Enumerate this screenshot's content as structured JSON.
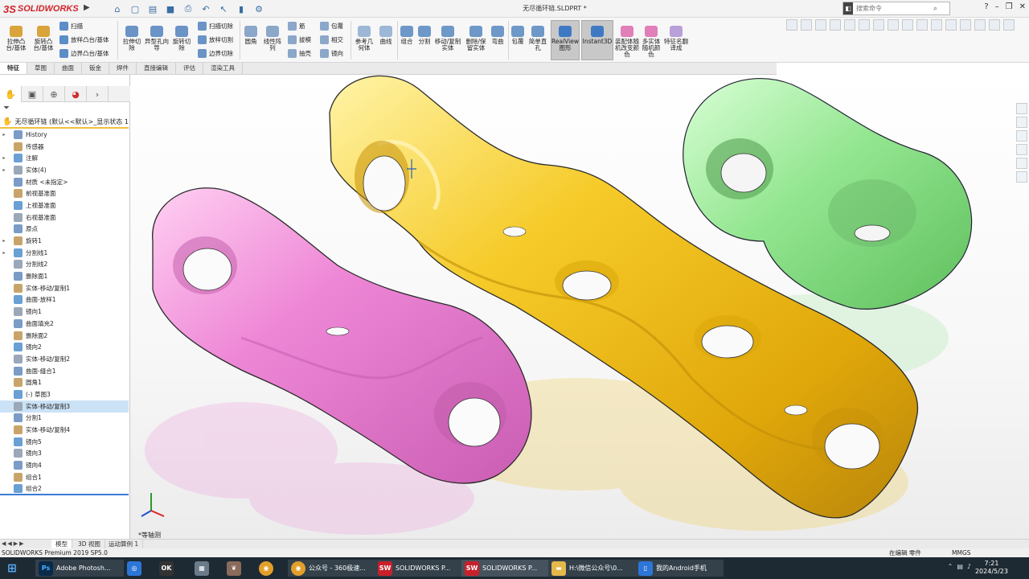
{
  "app": {
    "logo_ds": "3S",
    "logo_text": "SOLIDWORKS",
    "doc_title": "无尽循环链.SLDPRT *"
  },
  "search": {
    "placeholder": "搜索命令"
  },
  "quick_icons": [
    "home-icon",
    "new-doc-icon",
    "open-icon",
    "save-icon",
    "print-icon",
    "undo-icon",
    "select-icon",
    "rebuild-icon",
    "options-icon"
  ],
  "ribbon": {
    "extrude_boss": "拉伸凸台/基体",
    "revolve_boss": "旋转凸台/基体",
    "sweep": "扫描",
    "loft_boss": "放样凸台/基体",
    "boundary_boss": "边界凸台/基体",
    "extrude_cut": "拉伸切除",
    "hole_wizard": "异型孔向导",
    "revolve_cut": "旋转切除",
    "swept_cut": "扫描切除",
    "lofted_cut": "放样切割",
    "boundary_cut": "边界切除",
    "fillet": "圆角",
    "linear_pattern": "线性阵列",
    "rib": "筋",
    "draft": "拔模",
    "shell": "抽壳",
    "wrap": "包覆",
    "intersect": "相交",
    "mirror": "镜向",
    "ref_geometry": "参考几何体",
    "curves": "曲线",
    "combine": "组合",
    "split": "分割",
    "move_copy": "移动/复制实体",
    "delete_keep": "删除/保留实体",
    "flex": "弯曲",
    "wrap2": "包覆",
    "simple_hole": "简单直孔",
    "realview": "RealView图形",
    "instant3d": "Instant3D",
    "random_color_assembly": "装配体随机改变颜色",
    "random_color_body": "多实体随机颜色",
    "feature_translate": "特征名翻译成"
  },
  "command_tabs": [
    "特征",
    "草图",
    "曲面",
    "钣金",
    "焊件",
    "直接编辑",
    "评估",
    "渲染工具"
  ],
  "feature_tree": {
    "root": "无尽循环链 (默认<<默认>_显示状态 1",
    "items": [
      {
        "label": "History",
        "exp": "▸"
      },
      {
        "label": "传感器",
        "exp": ""
      },
      {
        "label": "注解",
        "exp": "▸"
      },
      {
        "label": "实体(4)",
        "exp": "▸"
      },
      {
        "label": "材质 <未指定>",
        "exp": ""
      },
      {
        "label": "前视基准面",
        "exp": ""
      },
      {
        "label": "上视基准面",
        "exp": ""
      },
      {
        "label": "右视基准面",
        "exp": ""
      },
      {
        "label": "原点",
        "exp": ""
      },
      {
        "label": "旋转1",
        "exp": "▸"
      },
      {
        "label": "分割线1",
        "exp": "▸"
      },
      {
        "label": "分割线2",
        "exp": ""
      },
      {
        "label": "删除面1",
        "exp": ""
      },
      {
        "label": "实体-移动/复制1",
        "exp": ""
      },
      {
        "label": "曲面-放样1",
        "exp": ""
      },
      {
        "label": "镜向1",
        "exp": ""
      },
      {
        "label": "曲面填充2",
        "exp": ""
      },
      {
        "label": "删除面2",
        "exp": ""
      },
      {
        "label": "镜向2",
        "exp": ""
      },
      {
        "label": "实体-移动/复制2",
        "exp": ""
      },
      {
        "label": "曲面-缝合1",
        "exp": ""
      },
      {
        "label": "圆角1",
        "exp": ""
      },
      {
        "label": "(-) 草图3",
        "exp": ""
      },
      {
        "label": "实体-移动/复制3",
        "exp": "",
        "sel": true
      },
      {
        "label": "分割1",
        "exp": ""
      },
      {
        "label": "实体-移动/复制4",
        "exp": ""
      },
      {
        "label": "镜向5",
        "exp": ""
      },
      {
        "label": "镜向3",
        "exp": ""
      },
      {
        "label": "镜向4",
        "exp": ""
      },
      {
        "label": "组合1",
        "exp": ""
      },
      {
        "label": "组合2",
        "exp": ""
      }
    ]
  },
  "viewport": {
    "view_label": "*等轴测"
  },
  "model_tabs": {
    "model": "模型",
    "view3d": "3D 视图",
    "motion": "运动算例 1"
  },
  "status": {
    "product": "SOLIDWORKS Premium 2019 SP5.0",
    "mode": "在编辑 零件",
    "units": "MMGS"
  },
  "taskbar": {
    "ps": "Adobe Photosh...",
    "chrome": "公众号 - 360极速...",
    "sw1": "SOLIDWORKS P...",
    "sw2": "SOLIDWORKS P...",
    "folder": "H:\\微信公众号\\0...",
    "phone": "我的Android手机",
    "time": "7:21",
    "date": "2024/5/23"
  },
  "colors": {
    "pink": "#ee86d6",
    "yellow": "#f2c11c",
    "green": "#8ee38c",
    "logo_red": "#d2232a"
  }
}
